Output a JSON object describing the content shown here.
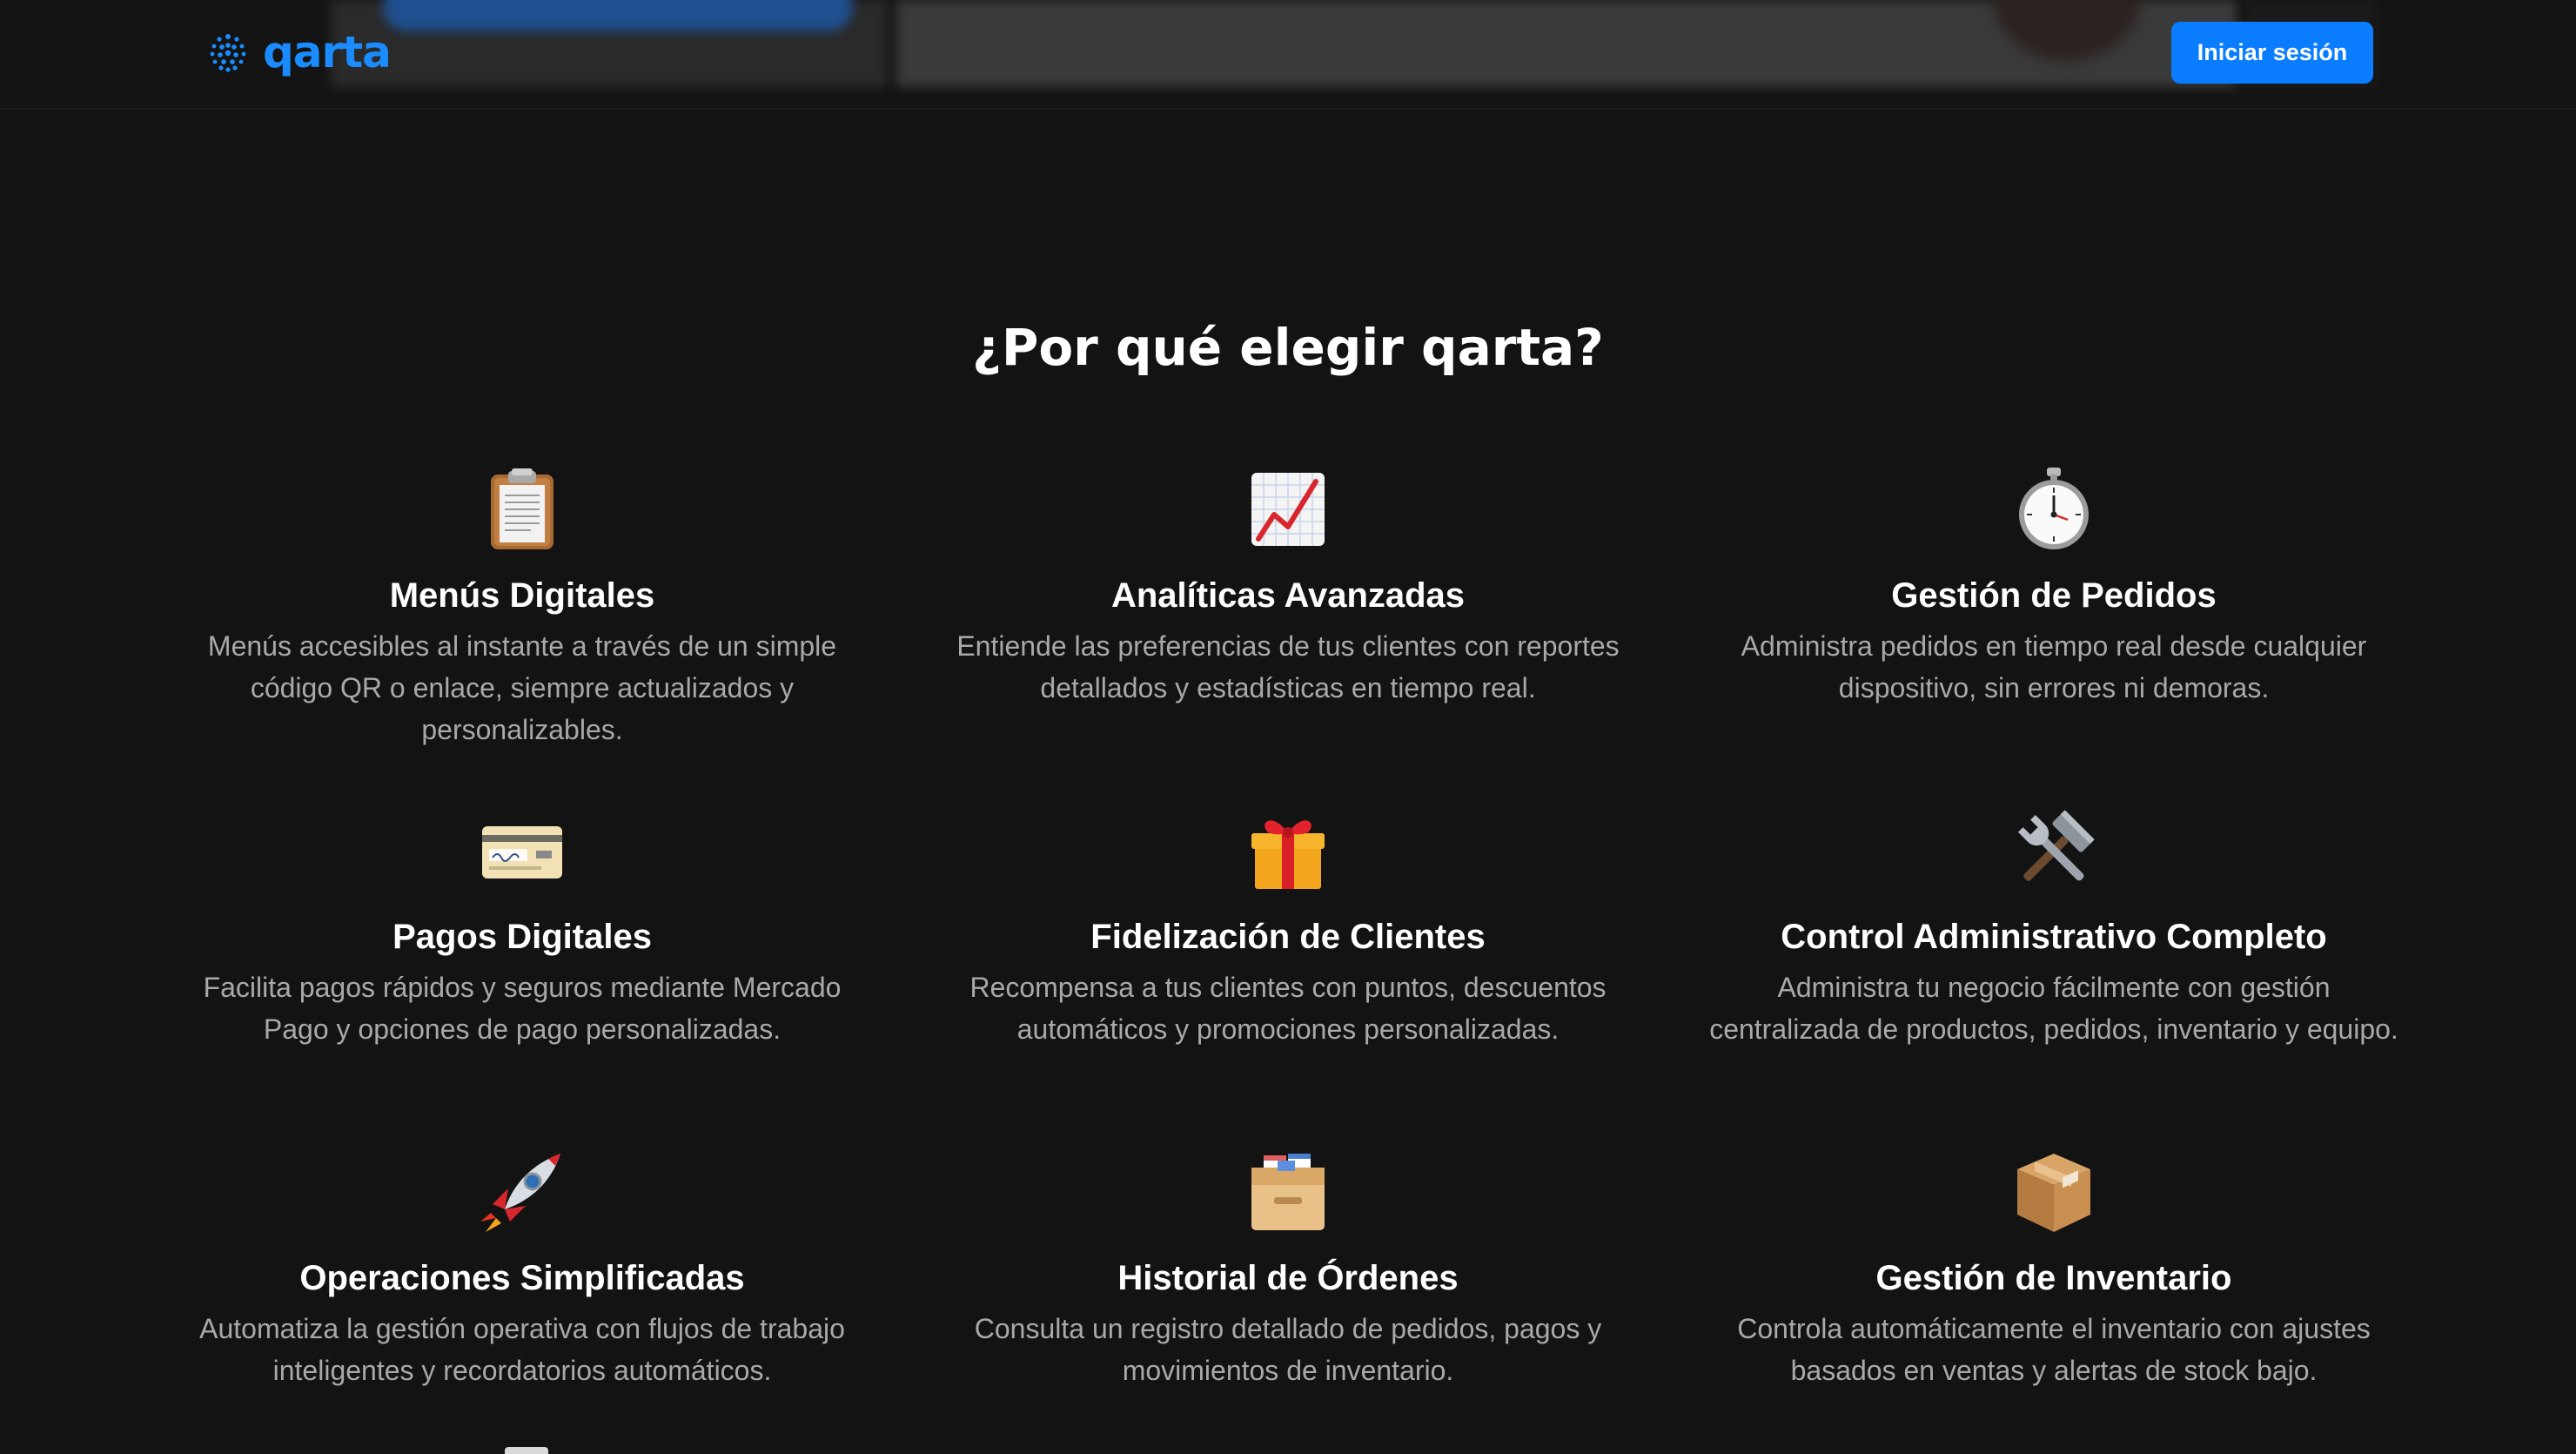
{
  "header": {
    "logo_text": "qarta",
    "login_label": "Iniciar sesión",
    "accent_color": "#0a7cff"
  },
  "section": {
    "title": "¿Por qué elegir qarta?"
  },
  "features": [
    {
      "icon": "clipboard-icon",
      "title": "Menús Digitales",
      "description": "Menús accesibles al instante a través de un simple código QR o enlace, siempre actualizados y personalizables."
    },
    {
      "icon": "chart-increasing-icon",
      "title": "Analíticas Avanzadas",
      "description": "Entiende las preferencias de tus clientes con reportes detallados y estadísticas en tiempo real."
    },
    {
      "icon": "stopwatch-icon",
      "title": "Gestión de Pedidos",
      "description": "Administra pedidos en tiempo real desde cualquier dispositivo, sin errores ni demoras."
    },
    {
      "icon": "credit-card-icon",
      "title": "Pagos Digitales",
      "description": "Facilita pagos rápidos y seguros mediante Mercado Pago y opciones de pago personalizadas."
    },
    {
      "icon": "gift-icon",
      "title": "Fidelización de Clientes",
      "description": "Recompensa a tus clientes con puntos, descuentos automáticos y promociones personalizadas."
    },
    {
      "icon": "hammer-wrench-icon",
      "title": "Control Administrativo Completo",
      "description": "Administra tu negocio fácilmente con gestión centralizada de productos, pedidos, inventario y equipo."
    },
    {
      "icon": "rocket-icon",
      "title": "Operaciones Simplificadas",
      "description": "Automatiza la gestión operativa con flujos de trabajo inteligentes y recordatorios automáticos."
    },
    {
      "icon": "card-file-box-icon",
      "title": "Historial de Órdenes",
      "description": "Consulta un registro detallado de pedidos, pagos y movimientos de inventario."
    },
    {
      "icon": "package-icon",
      "title": "Gestión de Inventario",
      "description": "Controla automáticamente el inventario con ajustes basados en ventas y alertas de stock bajo."
    }
  ]
}
